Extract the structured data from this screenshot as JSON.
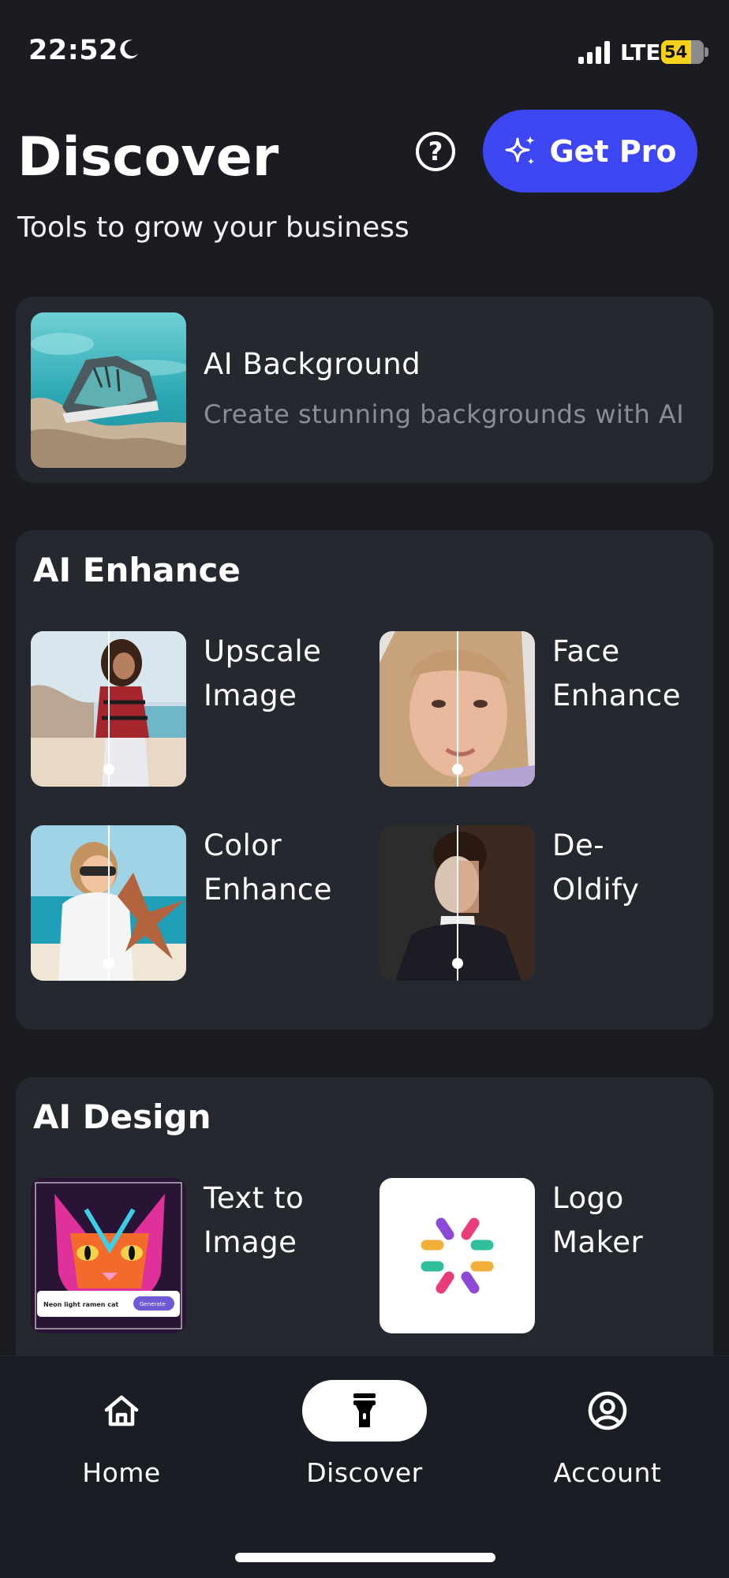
{
  "status_bar": {
    "time": "22:52",
    "network": "LTE",
    "battery": "54"
  },
  "header": {
    "title": "Discover",
    "subtitle": "Tools to grow your business",
    "help_symbol": "?",
    "get_pro_label": "Get Pro"
  },
  "ai_background": {
    "title": "AI Background",
    "description": "Create stunning backgrounds with AI"
  },
  "ai_enhance": {
    "title": "AI Enhance",
    "tools": [
      {
        "label": "Upscale\nImage"
      },
      {
        "label": "Face\nEnhance"
      },
      {
        "label": "Color\nEnhance"
      },
      {
        "label": "De-\nOldify"
      }
    ]
  },
  "ai_design": {
    "title": "AI Design",
    "tools": [
      {
        "label": "Text to\nImage"
      },
      {
        "label": "Logo\nMaker"
      }
    ],
    "prompt_text": "Neon light ramen cat",
    "generate_label": "Generate"
  },
  "bottom_nav": [
    {
      "label": "Home",
      "icon": "home-icon"
    },
    {
      "label": "Discover",
      "icon": "flashlight-icon",
      "active": true
    },
    {
      "label": "Account",
      "icon": "account-icon"
    }
  ],
  "colors": {
    "accent": "#3e46f2",
    "background": "#1a1c22",
    "card": "#262830"
  }
}
